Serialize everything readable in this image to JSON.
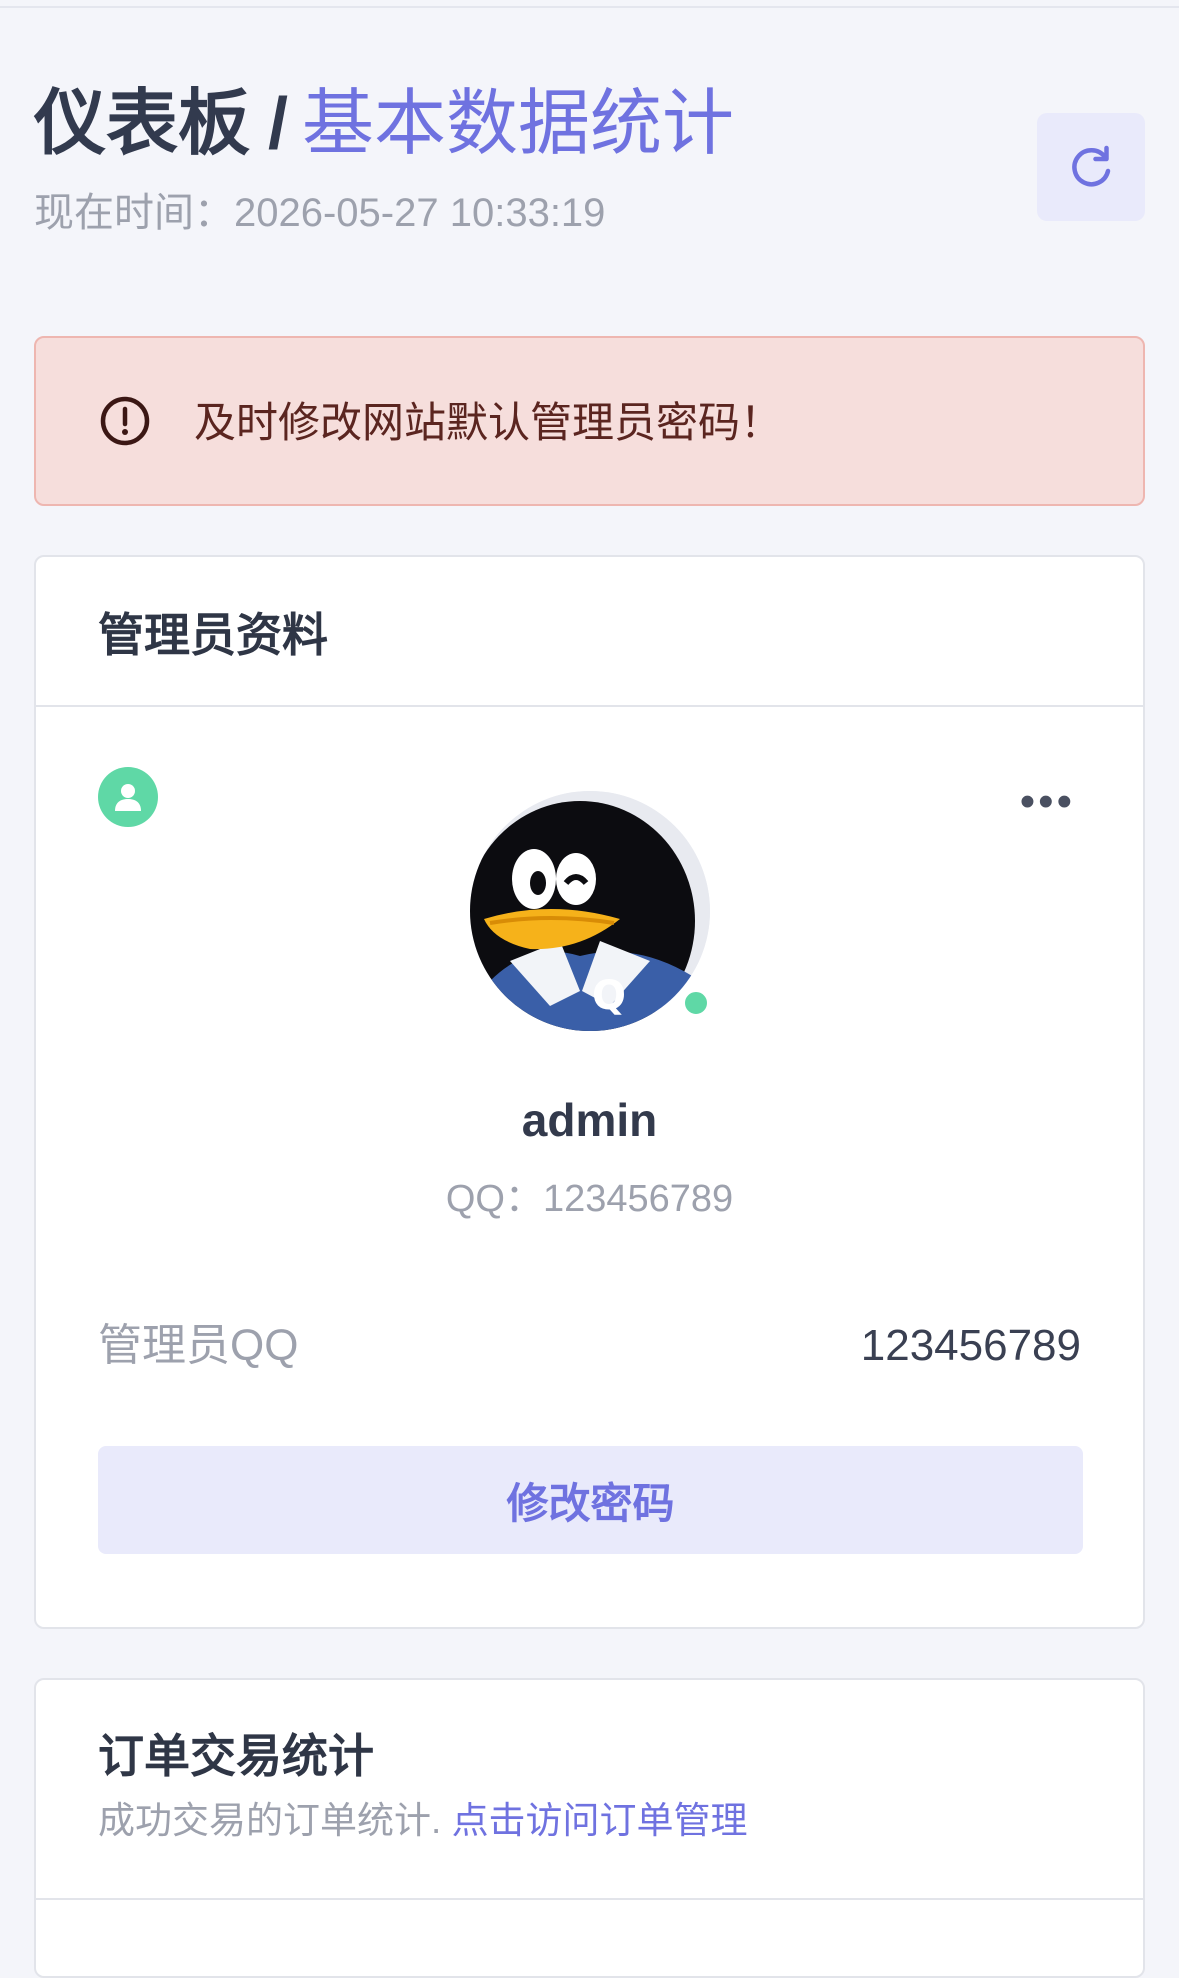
{
  "header": {
    "title_main": "仪表板",
    "title_sep": "/",
    "title_sub": "基本数据统计",
    "time_label": "现在时间：",
    "time_value": "2026-05-27 10:33:19"
  },
  "alert": {
    "text": "及时修改网站默认管理员密码！",
    "icon": "alert-circle-icon"
  },
  "admin_card": {
    "title": "管理员资料",
    "username": "admin",
    "qq_label": "QQ：",
    "qq": "123456789",
    "row_label": "管理员QQ",
    "row_value": "123456789",
    "change_password_label": "修改密码",
    "online": true
  },
  "order_card": {
    "title": "订单交易统计",
    "desc": "成功交易的订单统计. ",
    "link": "点击访问订单管理"
  },
  "colors": {
    "accent": "#6f72e0",
    "success": "#5fd8a6",
    "alert_bg": "#f6dedc",
    "alert_border": "#eeb6b0"
  }
}
